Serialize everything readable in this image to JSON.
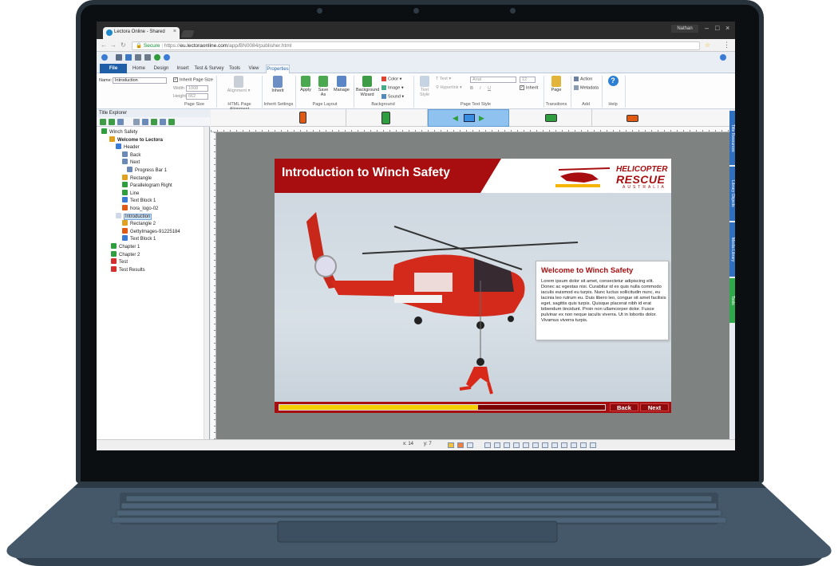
{
  "browser": {
    "tab_title": "Lectora Online - Shared",
    "tab_close": "×",
    "user": "Nathan",
    "secure_label": "Secure",
    "url_prefix": "https://",
    "url_domain": "eu.lectoraonline.com",
    "url_path": "/app/BN0084/publisher.html"
  },
  "ribbon": {
    "file_tab": "File",
    "tabs": [
      "Home",
      "Design",
      "Insert",
      "Test & Survey",
      "Tools",
      "View",
      "Properties"
    ],
    "active_tab": "Properties",
    "name_label": "Name:",
    "name_value": "Introduction",
    "inherit_page_size": "Inherit Page Size",
    "width_label": "Width",
    "width_value": "1008",
    "height_label": "Height",
    "height_value": "662",
    "page_size_group": "Page Size",
    "alignment_label": "Alignment",
    "html_alignment_group": "HTML Page Alignment",
    "inherit_label": "Inherit",
    "inherit_settings_group": "Inherit Settings",
    "apply_label": "Apply",
    "save_as_label": "Save As",
    "manage_label": "Manage",
    "page_layout_group": "Page Layout",
    "bg_wizard_label": "Background Wizard",
    "color_label": "Color",
    "image_label": "Image",
    "sound_label": "Sound",
    "background_group": "Background",
    "text_style_label": "Text Style",
    "text_label": "Text",
    "hyperlink_label": "Hyperlink",
    "font_value": "Arial",
    "font_size_value": "12",
    "inherit_check": "Inherit",
    "page_text_style_group": "Page Text Style",
    "page_label": "Page",
    "transitions_group": "Transitions",
    "action_label": "Action",
    "metadata_label": "Metadata",
    "add_group": "Add",
    "help_group": "Help"
  },
  "explorer": {
    "title": "Title Explorer",
    "items": [
      {
        "label": "Winch Safety",
        "bold": false
      },
      {
        "label": "Welcome to Lectora",
        "bold": true
      },
      {
        "label": "Header",
        "bold": false
      },
      {
        "label": "Back",
        "bold": false
      },
      {
        "label": "Next",
        "bold": false
      },
      {
        "label": "Progress Bar 1",
        "bold": false
      },
      {
        "label": "Rectangle",
        "bold": false
      },
      {
        "label": "Parallelogram Right",
        "bold": false
      },
      {
        "label": "Line",
        "bold": false
      },
      {
        "label": "Text Block 1",
        "bold": false
      },
      {
        "label": "hora_logo-02",
        "bold": false
      },
      {
        "label": "Introduction",
        "bold": false
      },
      {
        "label": "Rectangle 2",
        "bold": false
      },
      {
        "label": "GettyImages-91225184",
        "bold": false
      },
      {
        "label": "Text Block 1",
        "bold": false
      },
      {
        "label": "Chapter 1",
        "bold": false
      },
      {
        "label": "Chapter 2",
        "bold": false
      },
      {
        "label": "Test",
        "bold": false
      },
      {
        "label": "Test Results",
        "bold": false
      }
    ]
  },
  "side_tabs": [
    "Title Resources",
    "Library Objects",
    "Media Library",
    "Tools"
  ],
  "page": {
    "title": "Introduction to Winch Safety",
    "logo_line1": "HELICOPTER",
    "logo_line2": "RESCUE",
    "logo_line3": "AUSTRALIA",
    "info_title": "Welcome to Winch Safety",
    "info_body": "Lorem ipsum dolor sit amet, consectetur adipiscing elit. Donec ac egestas nisi. Curabitur id ex quis nulla commodo iaculis euismod eu turpis. Nunc luctus sollicitudin nunc, eu lacinia leo rutrum eu. Duis libero leo, congue sit amet facilisis eget, sagittis quis turpis. Quisque placerat nibh id erat bibendum tincidunt. Proin non ullamcorper dolor. Fusce pulvinar ex non neque iaculis viverra. Ut in lobortis dolor. Vivamus viverra turpis.",
    "progress_fraction": 0.61,
    "back_label": "Back",
    "next_label": "Next"
  },
  "status": {
    "x_label": "x: 14",
    "y_label": "y: 7"
  },
  "colors": {
    "brand_red": "#a80e10",
    "progress_yellow": "#f5d000",
    "ribbon_blue": "#1f5fa8"
  }
}
